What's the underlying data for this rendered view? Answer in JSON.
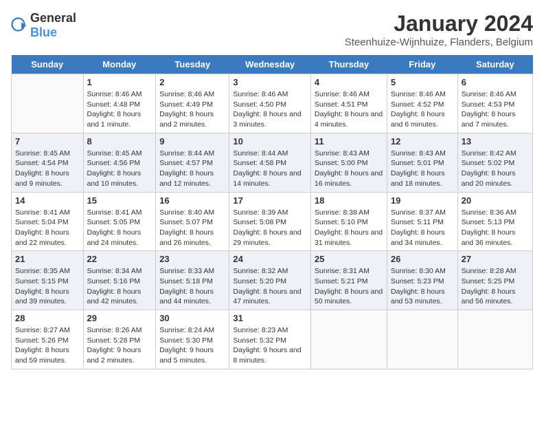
{
  "header": {
    "logo_general": "General",
    "logo_blue": "Blue",
    "title": "January 2024",
    "subtitle": "Steenhuize-Wijnhuize, Flanders, Belgium"
  },
  "days_of_week": [
    "Sunday",
    "Monday",
    "Tuesday",
    "Wednesday",
    "Thursday",
    "Friday",
    "Saturday"
  ],
  "weeks": [
    [
      {
        "day": "",
        "empty": true
      },
      {
        "day": "1",
        "sunrise": "8:46 AM",
        "sunset": "4:48 PM",
        "daylight": "8 hours and 1 minute."
      },
      {
        "day": "2",
        "sunrise": "8:46 AM",
        "sunset": "4:49 PM",
        "daylight": "8 hours and 2 minutes."
      },
      {
        "day": "3",
        "sunrise": "8:46 AM",
        "sunset": "4:50 PM",
        "daylight": "8 hours and 3 minutes."
      },
      {
        "day": "4",
        "sunrise": "8:46 AM",
        "sunset": "4:51 PM",
        "daylight": "8 hours and 4 minutes."
      },
      {
        "day": "5",
        "sunrise": "8:46 AM",
        "sunset": "4:52 PM",
        "daylight": "8 hours and 6 minutes."
      },
      {
        "day": "6",
        "sunrise": "8:46 AM",
        "sunset": "4:53 PM",
        "daylight": "8 hours and 7 minutes."
      }
    ],
    [
      {
        "day": "7",
        "sunrise": "8:45 AM",
        "sunset": "4:54 PM",
        "daylight": "8 hours and 9 minutes."
      },
      {
        "day": "8",
        "sunrise": "8:45 AM",
        "sunset": "4:56 PM",
        "daylight": "8 hours and 10 minutes."
      },
      {
        "day": "9",
        "sunrise": "8:44 AM",
        "sunset": "4:57 PM",
        "daylight": "8 hours and 12 minutes."
      },
      {
        "day": "10",
        "sunrise": "8:44 AM",
        "sunset": "4:58 PM",
        "daylight": "8 hours and 14 minutes."
      },
      {
        "day": "11",
        "sunrise": "8:43 AM",
        "sunset": "5:00 PM",
        "daylight": "8 hours and 16 minutes."
      },
      {
        "day": "12",
        "sunrise": "8:43 AM",
        "sunset": "5:01 PM",
        "daylight": "8 hours and 18 minutes."
      },
      {
        "day": "13",
        "sunrise": "8:42 AM",
        "sunset": "5:02 PM",
        "daylight": "8 hours and 20 minutes."
      }
    ],
    [
      {
        "day": "14",
        "sunrise": "8:41 AM",
        "sunset": "5:04 PM",
        "daylight": "8 hours and 22 minutes."
      },
      {
        "day": "15",
        "sunrise": "8:41 AM",
        "sunset": "5:05 PM",
        "daylight": "8 hours and 24 minutes."
      },
      {
        "day": "16",
        "sunrise": "8:40 AM",
        "sunset": "5:07 PM",
        "daylight": "8 hours and 26 minutes."
      },
      {
        "day": "17",
        "sunrise": "8:39 AM",
        "sunset": "5:08 PM",
        "daylight": "8 hours and 29 minutes."
      },
      {
        "day": "18",
        "sunrise": "8:38 AM",
        "sunset": "5:10 PM",
        "daylight": "8 hours and 31 minutes."
      },
      {
        "day": "19",
        "sunrise": "8:37 AM",
        "sunset": "5:11 PM",
        "daylight": "8 hours and 34 minutes."
      },
      {
        "day": "20",
        "sunrise": "8:36 AM",
        "sunset": "5:13 PM",
        "daylight": "8 hours and 36 minutes."
      }
    ],
    [
      {
        "day": "21",
        "sunrise": "8:35 AM",
        "sunset": "5:15 PM",
        "daylight": "8 hours and 39 minutes."
      },
      {
        "day": "22",
        "sunrise": "8:34 AM",
        "sunset": "5:16 PM",
        "daylight": "8 hours and 42 minutes."
      },
      {
        "day": "23",
        "sunrise": "8:33 AM",
        "sunset": "5:18 PM",
        "daylight": "8 hours and 44 minutes."
      },
      {
        "day": "24",
        "sunrise": "8:32 AM",
        "sunset": "5:20 PM",
        "daylight": "8 hours and 47 minutes."
      },
      {
        "day": "25",
        "sunrise": "8:31 AM",
        "sunset": "5:21 PM",
        "daylight": "8 hours and 50 minutes."
      },
      {
        "day": "26",
        "sunrise": "8:30 AM",
        "sunset": "5:23 PM",
        "daylight": "8 hours and 53 minutes."
      },
      {
        "day": "27",
        "sunrise": "8:28 AM",
        "sunset": "5:25 PM",
        "daylight": "8 hours and 56 minutes."
      }
    ],
    [
      {
        "day": "28",
        "sunrise": "8:27 AM",
        "sunset": "5:26 PM",
        "daylight": "8 hours and 59 minutes."
      },
      {
        "day": "29",
        "sunrise": "8:26 AM",
        "sunset": "5:28 PM",
        "daylight": "9 hours and 2 minutes."
      },
      {
        "day": "30",
        "sunrise": "8:24 AM",
        "sunset": "5:30 PM",
        "daylight": "9 hours and 5 minutes."
      },
      {
        "day": "31",
        "sunrise": "8:23 AM",
        "sunset": "5:32 PM",
        "daylight": "9 hours and 8 minutes."
      },
      {
        "day": "",
        "empty": true
      },
      {
        "day": "",
        "empty": true
      },
      {
        "day": "",
        "empty": true
      }
    ]
  ]
}
